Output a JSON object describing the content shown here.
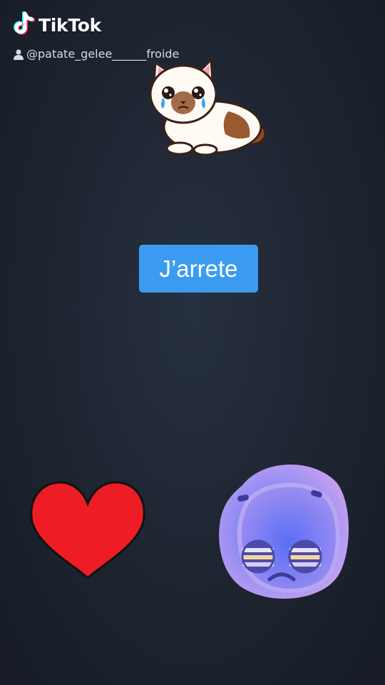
{
  "watermark": {
    "brand": "TikTok",
    "username": "@patate_gelee______froide",
    "logo_icon": "tiktok-note-icon",
    "user_icon": "person-icon"
  },
  "caption": {
    "text": "J’arrete",
    "background": "#3b9bf0"
  },
  "stickers": {
    "cat": "crying-cat-sticker",
    "heart": "red-heart-sticker",
    "heart_color": "#ee1c25",
    "blob": "sad-purple-blob-sticker",
    "blob_color": "#b48cf0"
  },
  "background": "#1d2430"
}
